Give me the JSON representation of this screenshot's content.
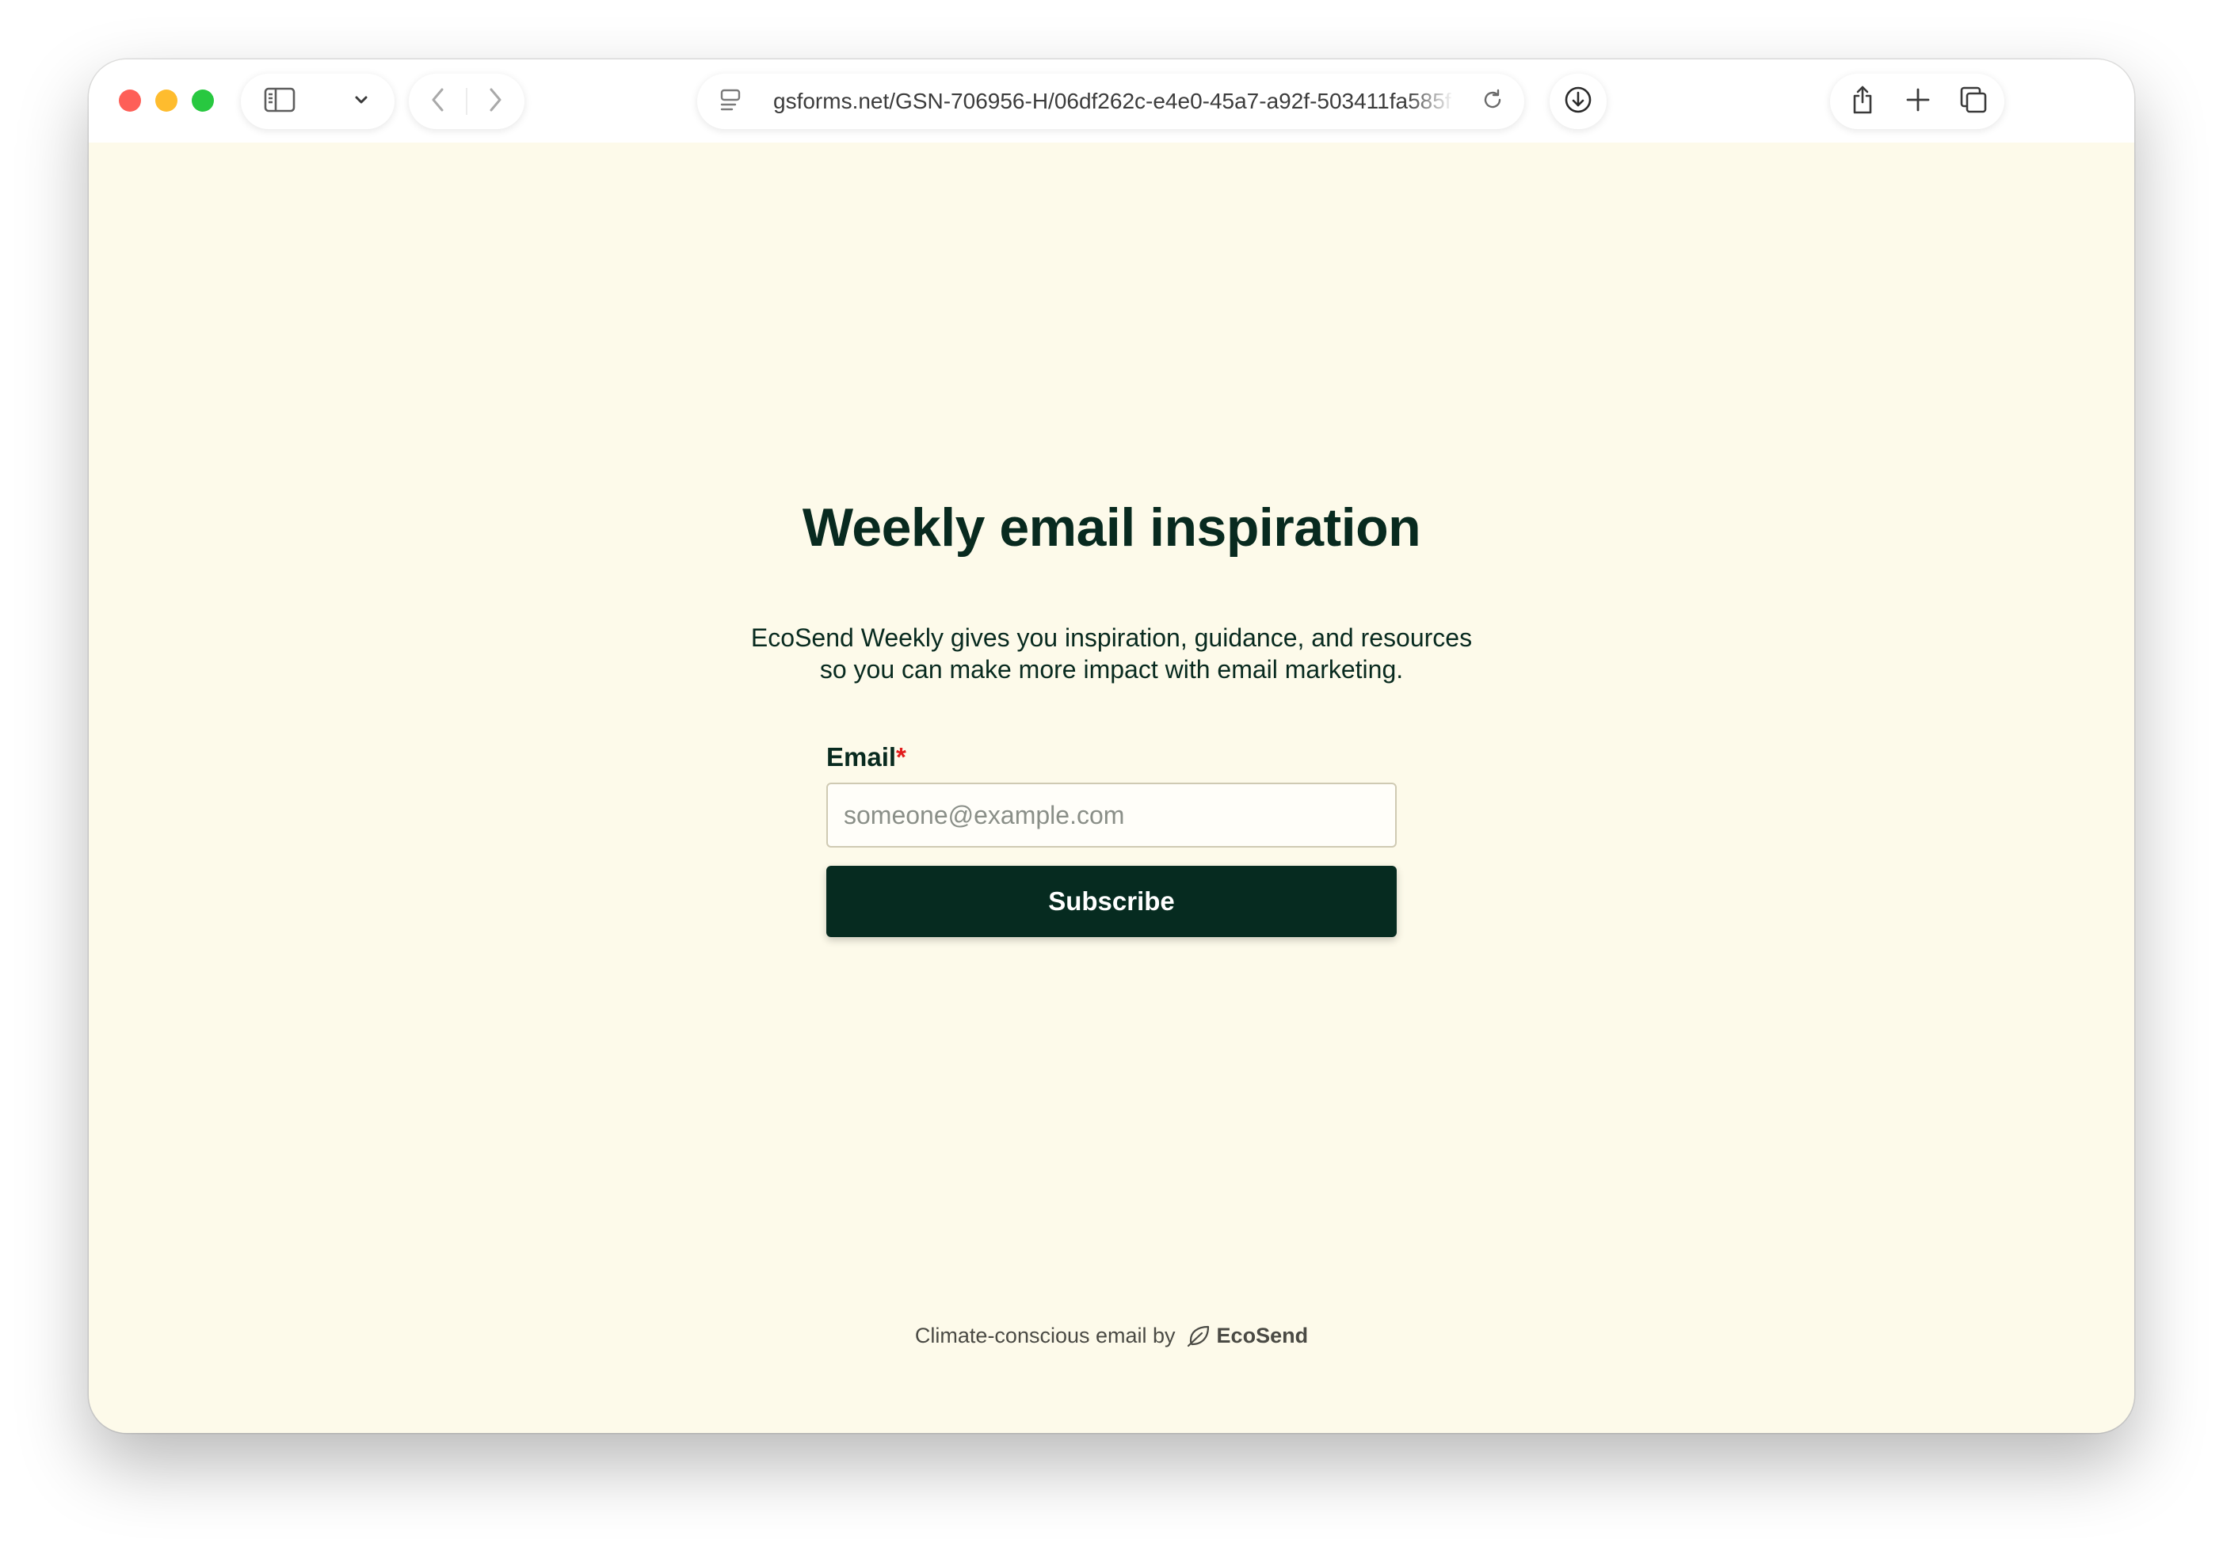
{
  "browser": {
    "url": "gsforms.net/GSN-706956-H/06df262c-e4e0-45a7-a92f-503411fa585f",
    "icons": {
      "sidebar": "sidebar-icon",
      "dropdown": "chevron-down-icon",
      "back": "chevron-left-icon",
      "forward": "chevron-right-icon",
      "reader": "reader-mode-icon",
      "reload": "reload-icon",
      "download": "download-icon",
      "share": "share-icon",
      "new_tab": "plus-icon",
      "tabs": "tab-overview-icon"
    }
  },
  "form": {
    "title": "Weekly email inspiration",
    "description_line1": "EcoSend Weekly gives you inspiration, guidance, and resources",
    "description_line2": "so you can make more impact with email marketing.",
    "email_label": "Email",
    "required_mark": "*",
    "email_placeholder": "someone@example.com",
    "email_value": "",
    "submit_label": "Subscribe"
  },
  "footer": {
    "text": "Climate-conscious email by",
    "brand": "EcoSend",
    "brand_icon": "leaf-icon"
  },
  "colors": {
    "page_background": "#fdfaea",
    "primary_dark": "#062b20",
    "required": "#e21d1d"
  }
}
